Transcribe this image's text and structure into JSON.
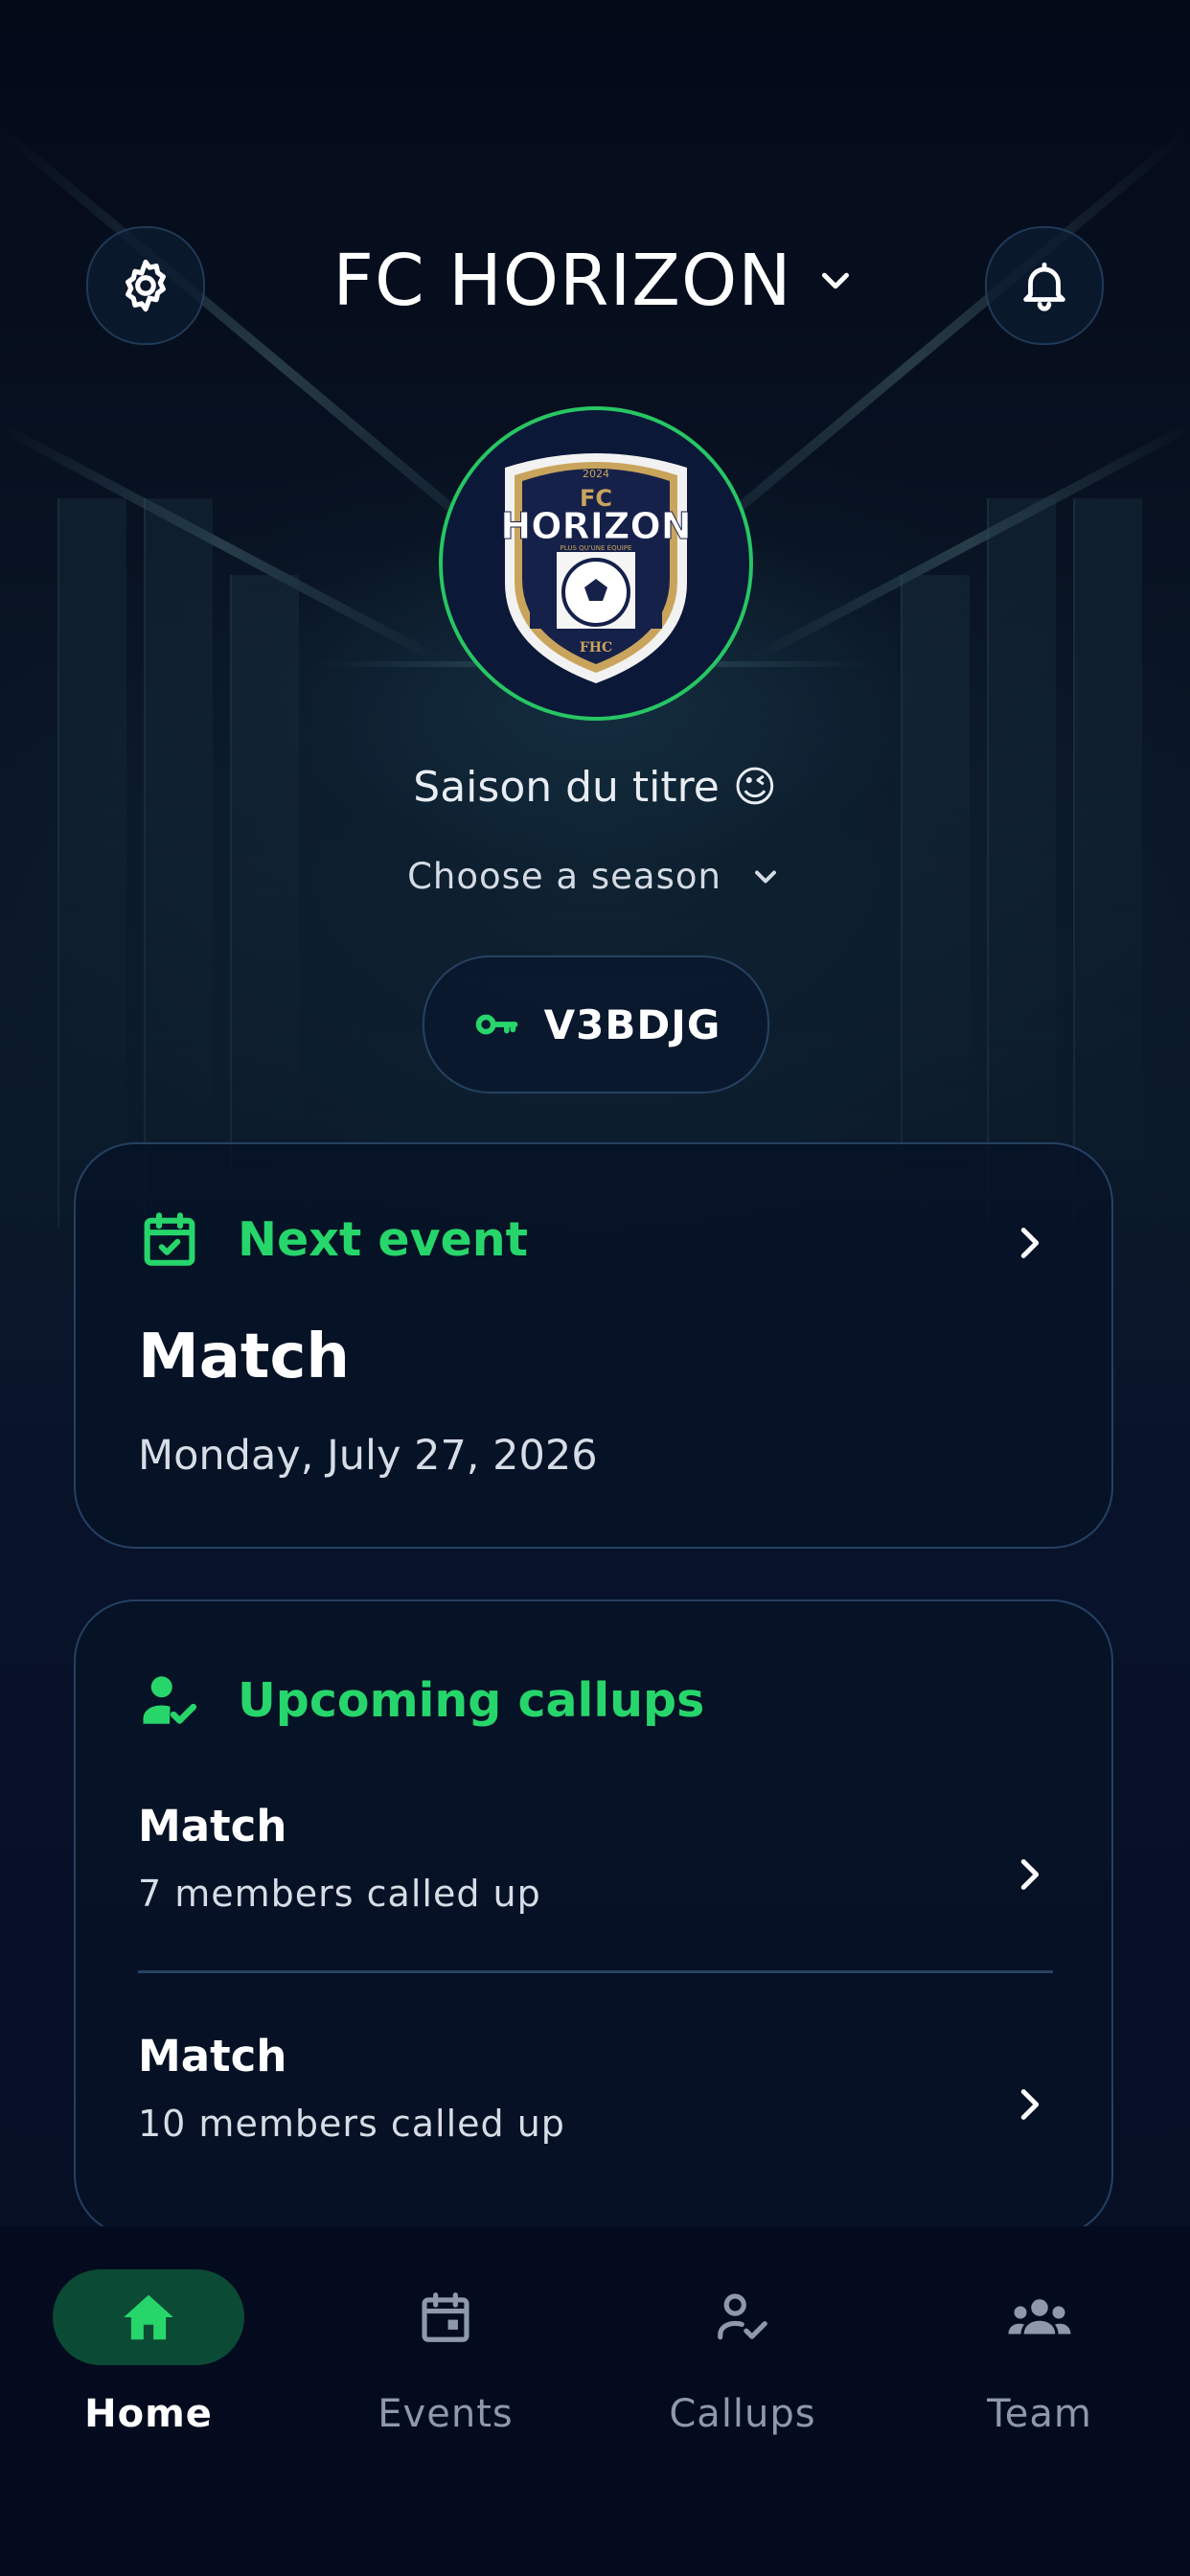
{
  "header": {
    "team_name": "FC HORIZON",
    "settings_icon": "gear-icon",
    "notifications_icon": "bell-icon"
  },
  "crest": {
    "year": "2024",
    "top_text": "FC",
    "name": "HORIZON",
    "motto": "PLUS QU'UNE ÉQUIPE",
    "monogram": "FHC"
  },
  "season": {
    "title": "Saison du titre 😉",
    "selector_placeholder": "Choose a season"
  },
  "invite": {
    "code": "V3BDJG",
    "icon": "key-icon"
  },
  "next_event": {
    "header_label": "Next event",
    "type": "Match",
    "date": "Monday, July 27, 2026"
  },
  "callups": {
    "header_label": "Upcoming callups",
    "items": [
      {
        "title": "Match",
        "subtitle": "7 members called up"
      },
      {
        "title": "Match",
        "subtitle": "10 members called up"
      }
    ]
  },
  "tabs": [
    {
      "label": "Home",
      "icon": "home-icon",
      "active": true
    },
    {
      "label": "Events",
      "icon": "calendar-icon",
      "active": false
    },
    {
      "label": "Callups",
      "icon": "person-check-icon",
      "active": false
    },
    {
      "label": "Team",
      "icon": "group-icon",
      "active": false
    }
  ],
  "colors": {
    "accent_green": "#27d66b",
    "background": "#050b1c",
    "card_border": "#32557d",
    "tab_active_bg": "#0b4a34"
  }
}
